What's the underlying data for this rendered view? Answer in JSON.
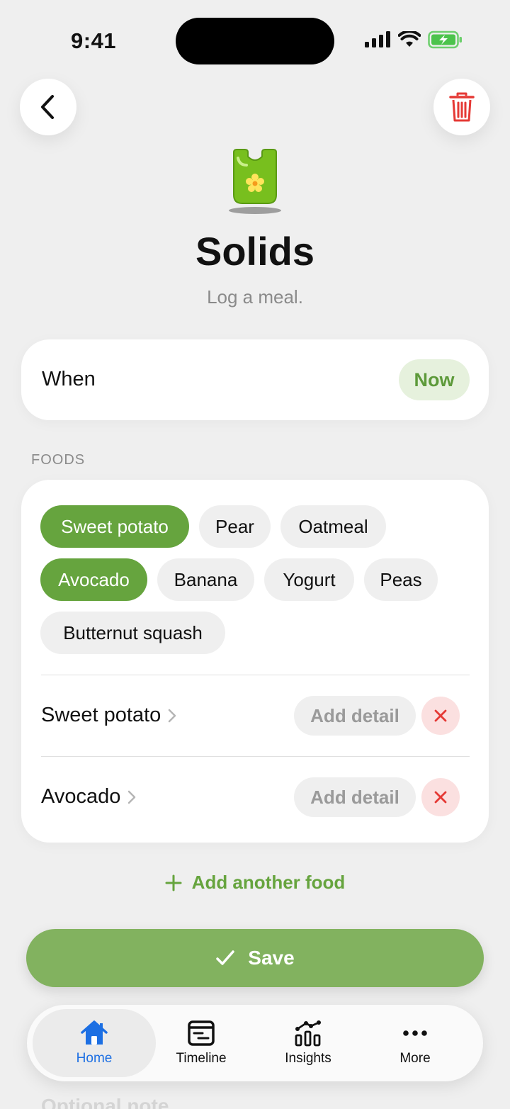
{
  "status_bar": {
    "time": "9:41"
  },
  "header": {
    "title": "Solids",
    "subtitle": "Log a meal."
  },
  "when": {
    "label": "When",
    "value": "Now"
  },
  "foods": {
    "section_label": "FOODS",
    "chips": [
      {
        "label": "Sweet potato",
        "selected": true
      },
      {
        "label": "Pear",
        "selected": false
      },
      {
        "label": "Oatmeal",
        "selected": false
      },
      {
        "label": "Avocado",
        "selected": true
      },
      {
        "label": "Banana",
        "selected": false
      },
      {
        "label": "Yogurt",
        "selected": false
      },
      {
        "label": "Peas",
        "selected": false
      },
      {
        "label": "Butternut squash",
        "selected": false
      }
    ],
    "selected_rows": [
      {
        "name": "Sweet potato",
        "detail_label": "Add detail"
      },
      {
        "name": "Avocado",
        "detail_label": "Add detail"
      }
    ],
    "add_another": "Add another food"
  },
  "hidden_section_label": "Optional note",
  "save_label": "Save",
  "tabs": [
    {
      "label": "Home",
      "icon": "home-icon",
      "active": true
    },
    {
      "label": "Timeline",
      "icon": "timeline-icon",
      "active": false
    },
    {
      "label": "Insights",
      "icon": "insights-icon",
      "active": false
    },
    {
      "label": "More",
      "icon": "more-icon",
      "active": false
    }
  ],
  "colors": {
    "accent_green": "#66a43e",
    "save_green": "#82b25f",
    "tab_active_blue": "#1c6fe3",
    "danger_red": "#e53935"
  }
}
